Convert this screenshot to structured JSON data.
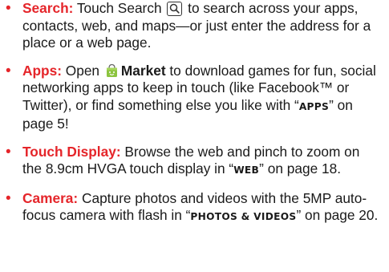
{
  "items": [
    {
      "heading": "Search:",
      "text_before_icon": " Touch Search ",
      "icon": "search-icon",
      "text_after_icon": " to search across your apps, contacts, web, and maps—or just enter the address for a place or a web page."
    },
    {
      "heading": "Apps:",
      "text_before_icon": " Open ",
      "icon": "market-bag-icon",
      "strong": "Market",
      "text_after_strong": " to download games for fun, social networking apps to keep in touch (like Facebook™ or Twitter), or find something else you like with “",
      "ref": "APPS",
      "text_after_ref": "” on page 5!"
    },
    {
      "heading": "Touch Display:",
      "text_before_ref": " Browse the web and pinch to zoom on the 8.9cm HVGA touch display in “",
      "ref": "WEB",
      "text_after_ref": "” on page 18."
    },
    {
      "heading": "Camera:",
      "text_before_ref": " Capture photos and videos with the 5MP auto-focus camera with flash in “",
      "ref": "PHOTOS & VIDEOS",
      "text_after_ref": "” on page 20."
    }
  ],
  "colors": {
    "accent": "#e5252a",
    "text": "#1a1a1a",
    "market_green": "#8cc43f"
  }
}
